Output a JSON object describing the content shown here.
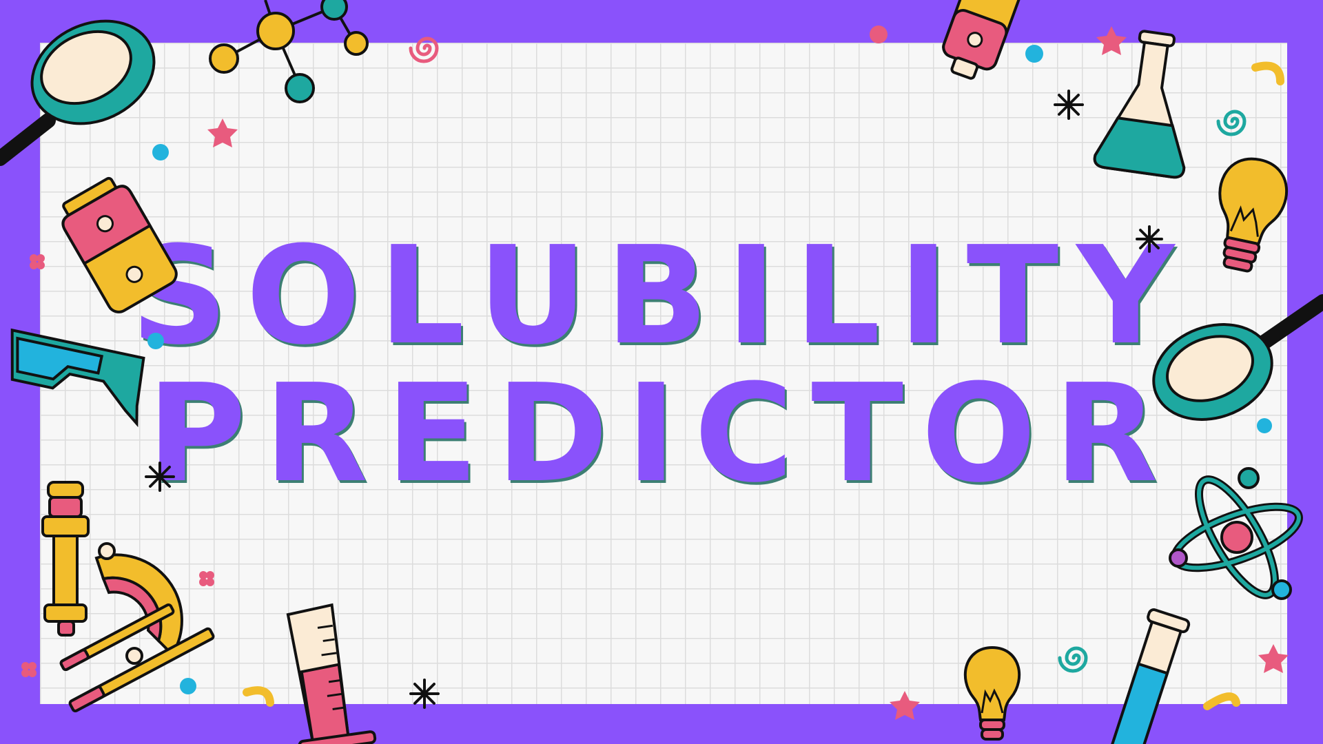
{
  "slide": {
    "title_line1": "SOLUBILITY",
    "title_line2": "PREDICTOR"
  },
  "colors": {
    "frame": "#8a52fb",
    "title": "#8a52fb",
    "title_shadow": "#3d7f73",
    "grid_background": "#f7f7f7",
    "grid_lines": "#dcdcdc",
    "teal": "#1ea8a0",
    "pink": "#e85b7e",
    "yellow": "#f2bd2c",
    "blue": "#22b3dd"
  },
  "decorations": [
    "magnifying-glass-icon",
    "molecule-icon",
    "battery-icon",
    "flask-icon",
    "light-bulb-icon",
    "safety-goggles-icon",
    "microscope-icon",
    "graduated-cylinder-icon",
    "atom-icon",
    "test-tube-icon"
  ]
}
